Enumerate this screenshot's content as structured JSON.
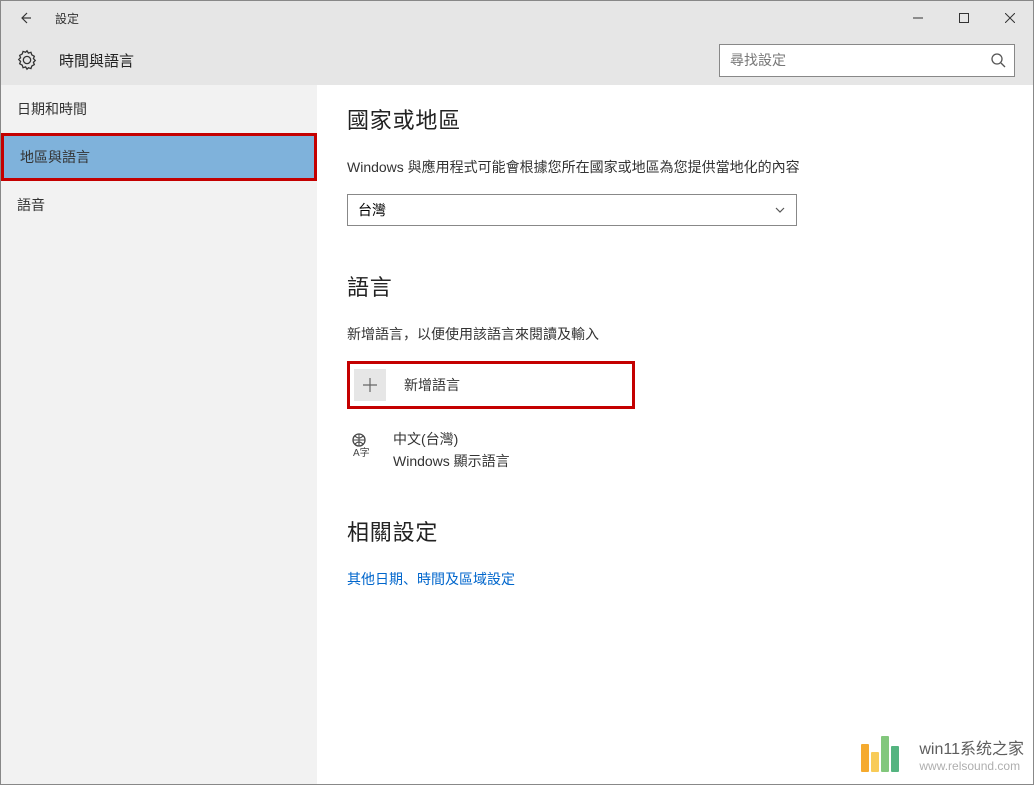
{
  "titlebar": {
    "title": "設定"
  },
  "header": {
    "page_title": "時間與語言",
    "search_placeholder": "尋找設定"
  },
  "sidebar": {
    "items": [
      {
        "label": "日期和時間",
        "selected": false
      },
      {
        "label": "地區與語言",
        "selected": true
      },
      {
        "label": "語音",
        "selected": false
      }
    ]
  },
  "content": {
    "region": {
      "heading": "國家或地區",
      "desc": "Windows 與應用程式可能會根據您所在國家或地區為您提供當地化的內容",
      "dropdown_value": "台灣"
    },
    "language": {
      "heading": "語言",
      "desc": "新增語言，以便使用該語言來閱讀及輸入",
      "add_label": "新增語言",
      "current_lang_name": "中文(台灣)",
      "current_lang_sub": "Windows 顯示語言"
    },
    "related": {
      "heading": "相關設定",
      "link_label": "其他日期、時間及區域設定"
    }
  },
  "watermark": {
    "main": "win11系统之家",
    "sub": "www.relsound.com"
  }
}
